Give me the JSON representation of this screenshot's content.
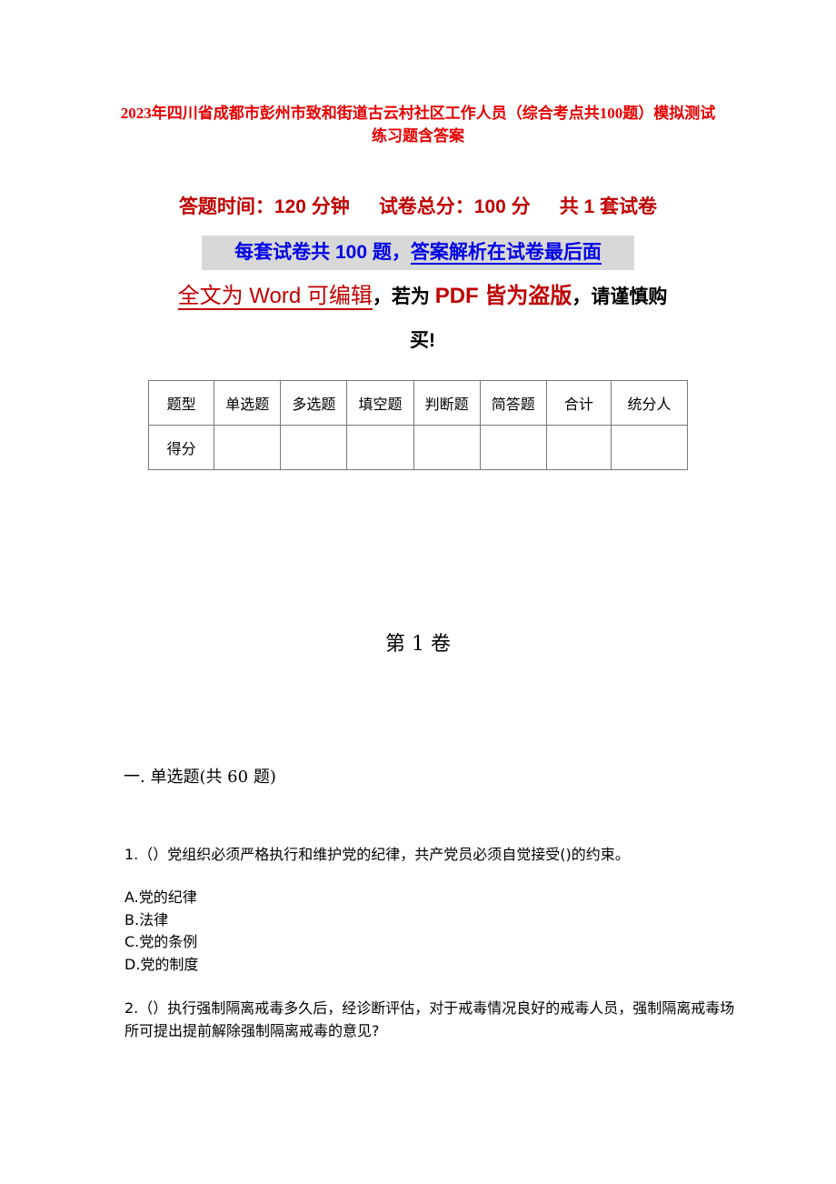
{
  "document": {
    "title": "2023年四川省成都市彭州市致和街道古云村社区工作人员（综合考点共100题）模拟测试练习题含答案",
    "meta": {
      "time": "答题时间：120 分钟",
      "total_score": "试卷总分：100 分",
      "sets": "共 1 套试卷"
    },
    "notice_blue": {
      "part1": "每套试卷共 100 题，",
      "part2": "答案解析在试卷最后面"
    },
    "notice_warn": {
      "part1": "全文为 Word 可编辑",
      "part2": "，若为 ",
      "part3": "PDF 皆为盗版",
      "part4": "，请谨慎购",
      "part5": "买!"
    },
    "score_table": {
      "header": [
        "题型",
        "单选题",
        "多选题",
        "填空题",
        "判断题",
        "简答题",
        "合计",
        "统分人"
      ],
      "row": [
        "得分",
        "",
        "",
        "",
        "",
        "",
        "",
        ""
      ]
    },
    "volume_title": "第 1 卷",
    "section_title": "一. 单选题(共 60 题)",
    "questions": [
      {
        "text": "1.（）党组织必须严格执行和维护党的纪律，共产党员必须自觉接受()的约束。",
        "options": [
          "A.党的纪律",
          "B.法律",
          "C.党的条例",
          "D.党的制度"
        ]
      },
      {
        "text": "2.（）执行强制隔离戒毒多久后，经诊断评估，对于戒毒情况良好的戒毒人员，强制隔离戒毒场所可提出提前解除强制隔离戒毒的意见?"
      }
    ],
    "colors": {
      "title_red": "#e60000",
      "meta_red": "#c00000",
      "notice_blue": "#0000e6",
      "highlight_gray": "#d8d8d8"
    }
  }
}
